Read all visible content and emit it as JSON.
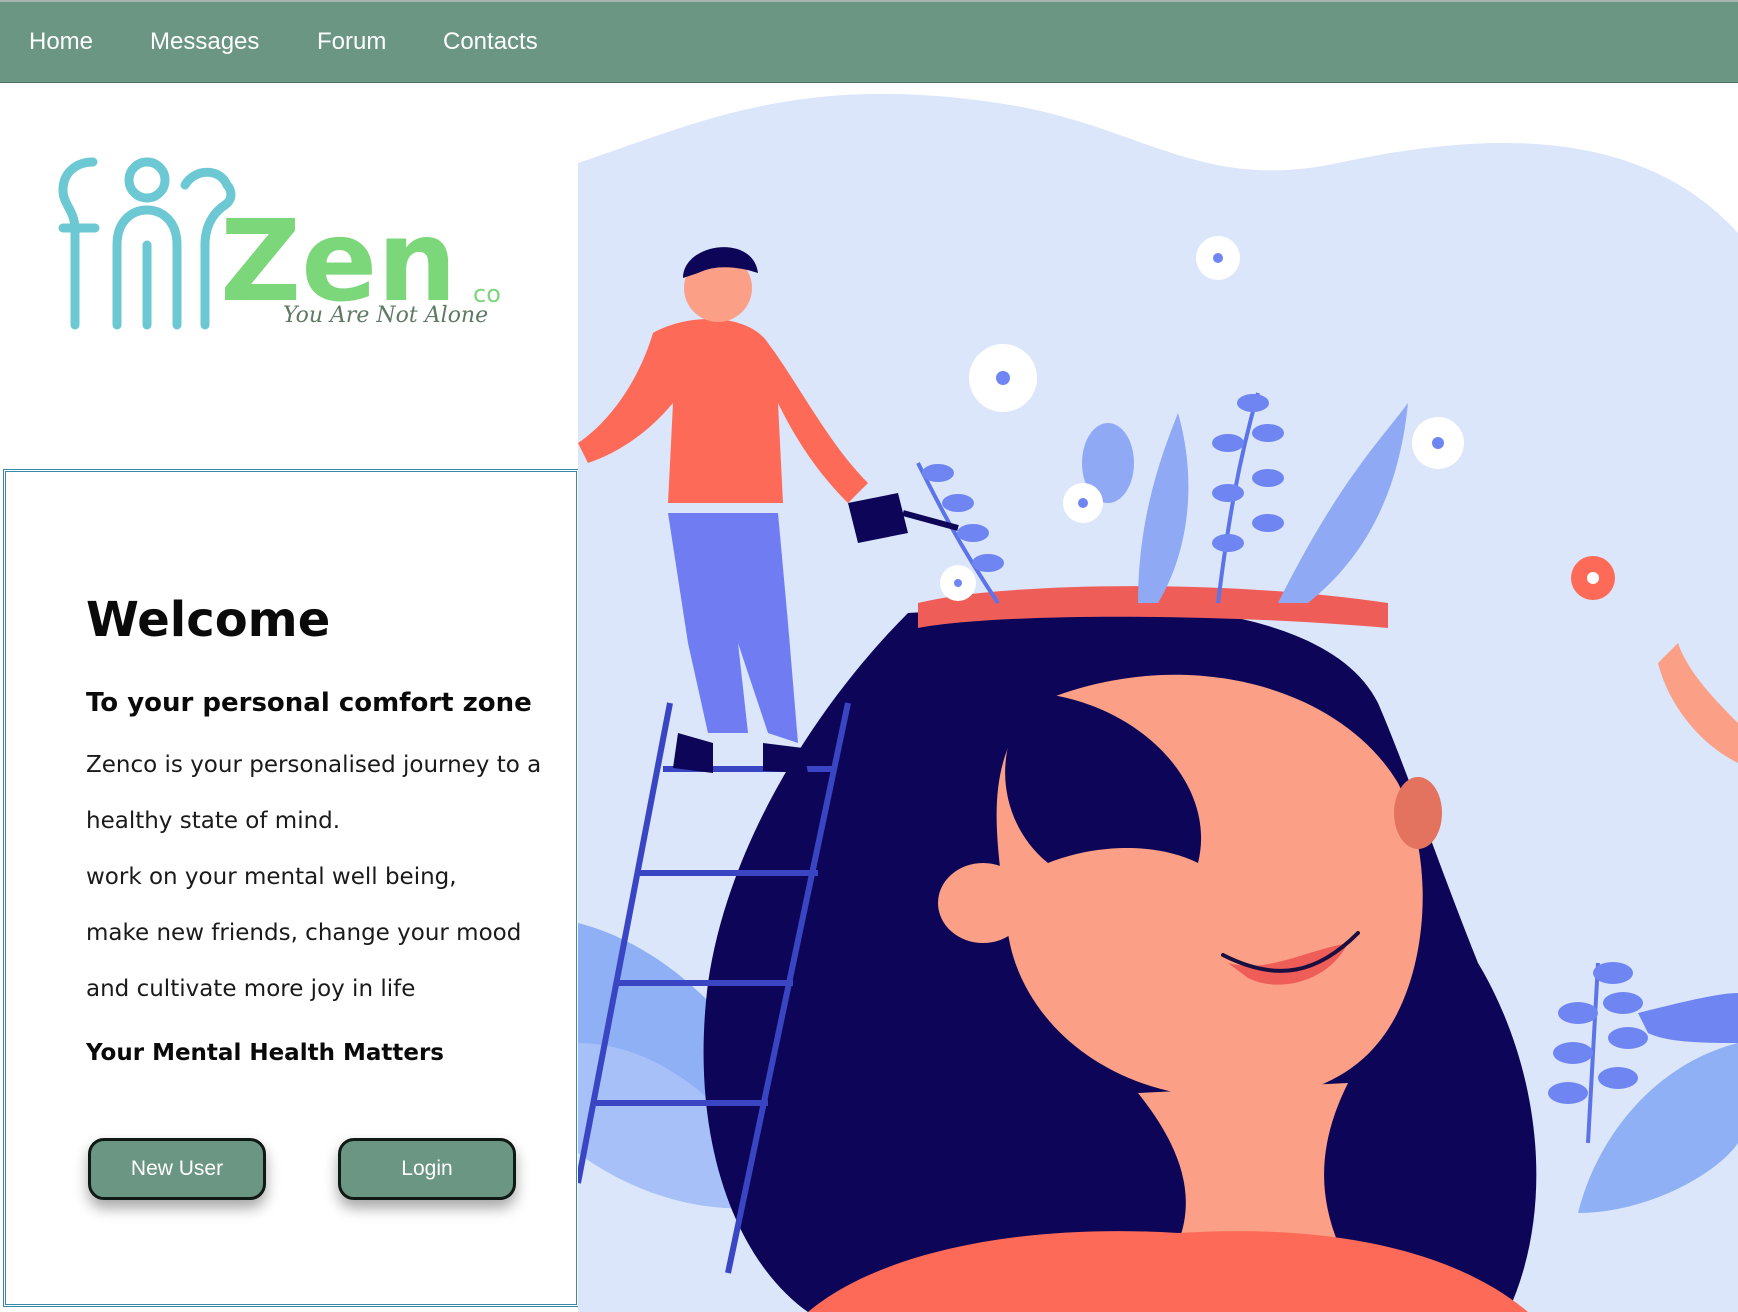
{
  "nav": {
    "items": [
      {
        "label": "Home"
      },
      {
        "label": "Messages"
      },
      {
        "label": "Forum"
      },
      {
        "label": "Contacts"
      }
    ]
  },
  "brand": {
    "name": "Zen",
    "suffix": "co",
    "tagline": "You Are Not Alone"
  },
  "welcome": {
    "title": "Welcome",
    "subtitle": "To your personal comfort zone",
    "lines": [
      "Zenco is your personalised journey to a",
      "healthy state of mind.",
      "work on your mental well being,",
      "make new friends, change your mood",
      "and cultivate more joy in life"
    ],
    "tagline": "Your Mental Health Matters"
  },
  "buttons": {
    "new_user": "New User",
    "login": "Login"
  },
  "colors": {
    "nav_bg": "#6b9683",
    "button_bg": "#6b9683",
    "card_border": "#3b8aa5",
    "logo_teal": "#6cc8d2",
    "logo_green": "#7cd67a"
  }
}
